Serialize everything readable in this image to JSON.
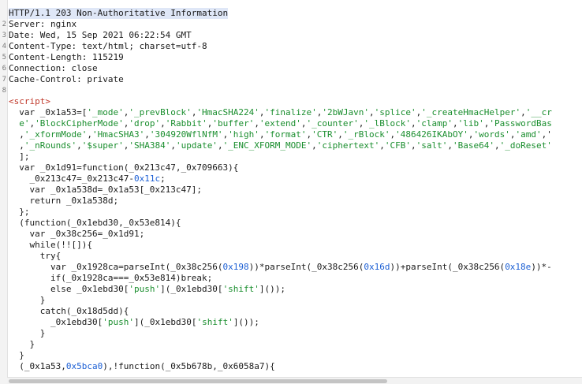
{
  "gutter": [
    "2",
    "3",
    "4",
    "5",
    "6",
    "7",
    "8"
  ],
  "lines": [
    [
      {
        "t": "HTTP/1.1 203 Non-Authoritative Information"
      }
    ],
    [
      {
        "t": "Server: nginx"
      }
    ],
    [
      {
        "t": "Date: Wed, 15 Sep 2021 06:22:54 GMT"
      }
    ],
    [
      {
        "t": "Content-Type: text/html; charset=utf-8"
      }
    ],
    [
      {
        "t": "Content-Length: 115219"
      }
    ],
    [
      {
        "t": "Connection: close"
      }
    ],
    [
      {
        "t": "Cache-Control: private"
      }
    ],
    [
      {
        "t": ""
      }
    ],
    [
      {
        "t": "<script>",
        "c": "tag"
      }
    ],
    [
      {
        "t": "  var _0x1a53=["
      },
      {
        "t": "'_mode'",
        "c": "str"
      },
      {
        "t": ","
      },
      {
        "t": "'_prevBlock'",
        "c": "str"
      },
      {
        "t": ","
      },
      {
        "t": "'HmacSHA224'",
        "c": "str"
      },
      {
        "t": ","
      },
      {
        "t": "'finalize'",
        "c": "str"
      },
      {
        "t": ","
      },
      {
        "t": "'2bWJavn'",
        "c": "str"
      },
      {
        "t": ","
      },
      {
        "t": "'splice'",
        "c": "str"
      },
      {
        "t": ","
      },
      {
        "t": "'_createHmacHelper'",
        "c": "str"
      },
      {
        "t": ","
      },
      {
        "t": "'__cr",
        "c": "str"
      }
    ],
    [
      {
        "t": "  "
      },
      {
        "t": "e'",
        "c": "str"
      },
      {
        "t": ","
      },
      {
        "t": "'BlockCipherMode'",
        "c": "str"
      },
      {
        "t": ","
      },
      {
        "t": "'drop'",
        "c": "str"
      },
      {
        "t": ","
      },
      {
        "t": "'Rabbit'",
        "c": "str"
      },
      {
        "t": ","
      },
      {
        "t": "'buffer'",
        "c": "str"
      },
      {
        "t": ","
      },
      {
        "t": "'extend'",
        "c": "str"
      },
      {
        "t": ","
      },
      {
        "t": "'_counter'",
        "c": "str"
      },
      {
        "t": ","
      },
      {
        "t": "'_lBlock'",
        "c": "str"
      },
      {
        "t": ","
      },
      {
        "t": "'clamp'",
        "c": "str"
      },
      {
        "t": ","
      },
      {
        "t": "'lib'",
        "c": "str"
      },
      {
        "t": ","
      },
      {
        "t": "'PasswordBas",
        "c": "str"
      }
    ],
    [
      {
        "t": "  ,"
      },
      {
        "t": "'_xformMode'",
        "c": "str"
      },
      {
        "t": ","
      },
      {
        "t": "'HmacSHA3'",
        "c": "str"
      },
      {
        "t": ","
      },
      {
        "t": "'304920WflNfM'",
        "c": "str"
      },
      {
        "t": ","
      },
      {
        "t": "'high'",
        "c": "str"
      },
      {
        "t": ","
      },
      {
        "t": "'format'",
        "c": "str"
      },
      {
        "t": ","
      },
      {
        "t": "'CTR'",
        "c": "str"
      },
      {
        "t": ","
      },
      {
        "t": "'_rBlock'",
        "c": "str"
      },
      {
        "t": ","
      },
      {
        "t": "'486426IKAbOY'",
        "c": "str"
      },
      {
        "t": ","
      },
      {
        "t": "'words'",
        "c": "str"
      },
      {
        "t": ","
      },
      {
        "t": "'amd'",
        "c": "str"
      },
      {
        "t": ",'"
      }
    ],
    [
      {
        "t": "  ,"
      },
      {
        "t": "'_nRounds'",
        "c": "str"
      },
      {
        "t": ","
      },
      {
        "t": "'$super'",
        "c": "str"
      },
      {
        "t": ","
      },
      {
        "t": "'SHA384'",
        "c": "str"
      },
      {
        "t": ","
      },
      {
        "t": "'update'",
        "c": "str"
      },
      {
        "t": ","
      },
      {
        "t": "'_ENC_XFORM_MODE'",
        "c": "str"
      },
      {
        "t": ","
      },
      {
        "t": "'ciphertext'",
        "c": "str"
      },
      {
        "t": ","
      },
      {
        "t": "'CFB'",
        "c": "str"
      },
      {
        "t": ","
      },
      {
        "t": "'salt'",
        "c": "str"
      },
      {
        "t": ","
      },
      {
        "t": "'Base64'",
        "c": "str"
      },
      {
        "t": ","
      },
      {
        "t": "'_doReset'",
        "c": "str"
      }
    ],
    [
      {
        "t": "  ];"
      }
    ],
    [
      {
        "t": "  var _0x1d91=function(_0x213c47,_0x709663){"
      }
    ],
    [
      {
        "t": "    _0x213c47=_0x213c47-"
      },
      {
        "t": "0x11c",
        "c": "num"
      },
      {
        "t": ";"
      }
    ],
    [
      {
        "t": "    var _0x1a538d=_0x1a53[_0x213c47];"
      }
    ],
    [
      {
        "t": "    return _0x1a538d;"
      }
    ],
    [
      {
        "t": "  };"
      }
    ],
    [
      {
        "t": "  (function(_0x1ebd30,_0x53e814){"
      }
    ],
    [
      {
        "t": "    var _0x38c256=_0x1d91;"
      }
    ],
    [
      {
        "t": "    while(!![]){"
      }
    ],
    [
      {
        "t": "      try{"
      }
    ],
    [
      {
        "t": "        var _0x1928ca=parseInt(_0x38c256("
      },
      {
        "t": "0x198",
        "c": "num"
      },
      {
        "t": "))*parseInt(_0x38c256("
      },
      {
        "t": "0x16d",
        "c": "num"
      },
      {
        "t": "))+parseInt(_0x38c256("
      },
      {
        "t": "0x18e",
        "c": "num"
      },
      {
        "t": "))*-"
      }
    ],
    [
      {
        "t": "        if(_0x1928ca===_0x53e814)break;"
      }
    ],
    [
      {
        "t": "        else _0x1ebd30["
      },
      {
        "t": "'push'",
        "c": "str"
      },
      {
        "t": "](_0x1ebd30["
      },
      {
        "t": "'shift'",
        "c": "str"
      },
      {
        "t": "]());"
      }
    ],
    [
      {
        "t": "      }"
      }
    ],
    [
      {
        "t": "      catch(_0x18d5dd){"
      }
    ],
    [
      {
        "t": "        _0x1ebd30["
      },
      {
        "t": "'push'",
        "c": "str"
      },
      {
        "t": "](_0x1ebd30["
      },
      {
        "t": "'shift'",
        "c": "str"
      },
      {
        "t": "]());"
      }
    ],
    [
      {
        "t": "      }"
      }
    ],
    [
      {
        "t": "    }"
      }
    ],
    [
      {
        "t": "  }"
      }
    ],
    [
      {
        "t": "  (_0x1a53,"
      },
      {
        "t": "0x5bca0",
        "c": "num"
      },
      {
        "t": "),!function(_0x5b678b,_0x6058a7){"
      }
    ]
  ]
}
